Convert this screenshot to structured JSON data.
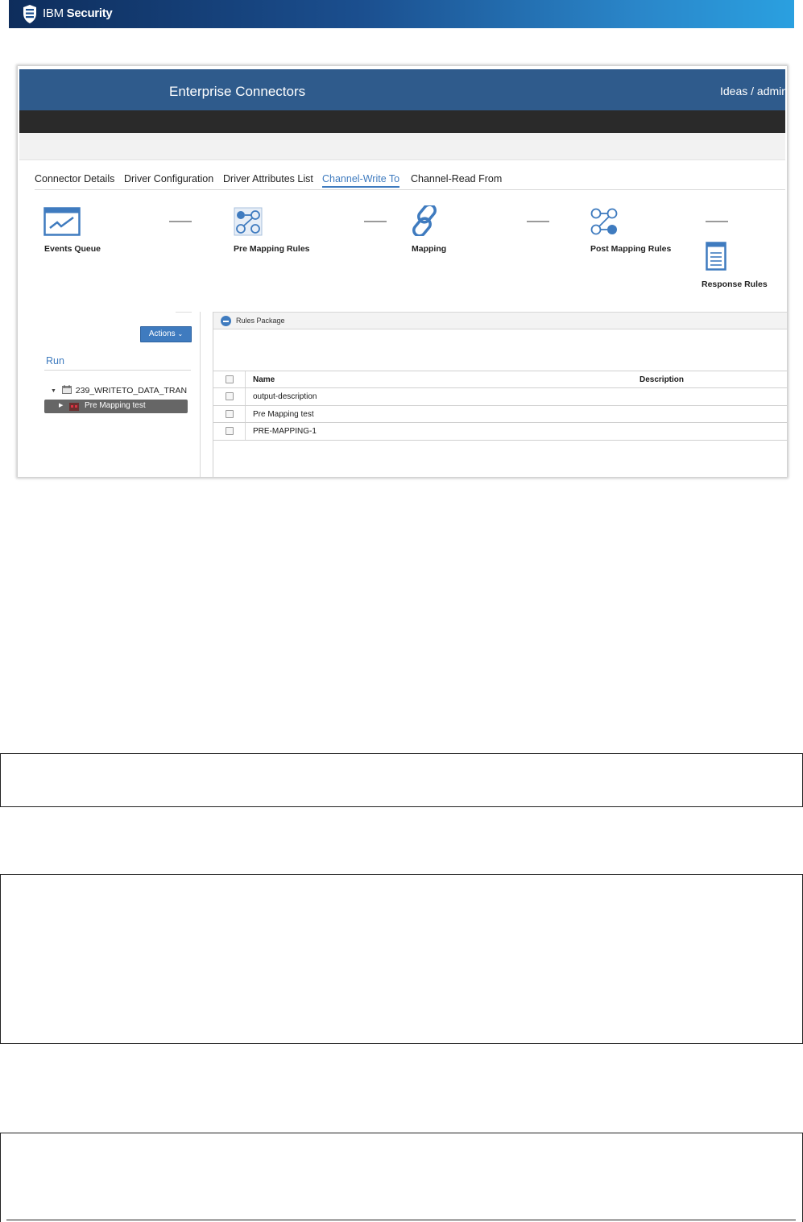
{
  "brand": {
    "ibm": "IBM",
    "security": "Security"
  },
  "app": {
    "title": "Enterprise Connectors",
    "user": "Ideas / admin"
  },
  "tabs": [
    {
      "label": "Connector Details"
    },
    {
      "label": "Driver Configuration"
    },
    {
      "label": "Driver Attributes List"
    },
    {
      "label": "Channel-Write To",
      "active": true
    },
    {
      "label": "Channel-Read From"
    }
  ],
  "steps": [
    {
      "label": "Events Queue",
      "icon": "events-queue-icon"
    },
    {
      "label": "Pre Mapping Rules",
      "icon": "pre-mapping-rules-icon"
    },
    {
      "label": "Mapping",
      "icon": "mapping-link-icon"
    },
    {
      "label": "Post Mapping Rules",
      "icon": "post-mapping-rules-icon"
    },
    {
      "label": "Response Rules",
      "icon": "response-rules-icon"
    }
  ],
  "left_panel": {
    "actions_label": "Actions",
    "run_tab": "Run",
    "tree": {
      "root": "239_WRITETO_DATA_TRAN",
      "selected": "Pre Mapping test"
    }
  },
  "rules_package": {
    "title": "Rules Package",
    "columns": {
      "name": "Name",
      "description": "Description"
    },
    "rows": [
      {
        "name": "output-description",
        "description": ""
      },
      {
        "name": "Pre Mapping test",
        "description": ""
      },
      {
        "name": "PRE-MAPPING-1",
        "description": ""
      }
    ]
  },
  "colors": {
    "accent": "#3f7bbf",
    "app_bar": "#2f5b8c",
    "dark_bar": "#2a2a2a"
  }
}
